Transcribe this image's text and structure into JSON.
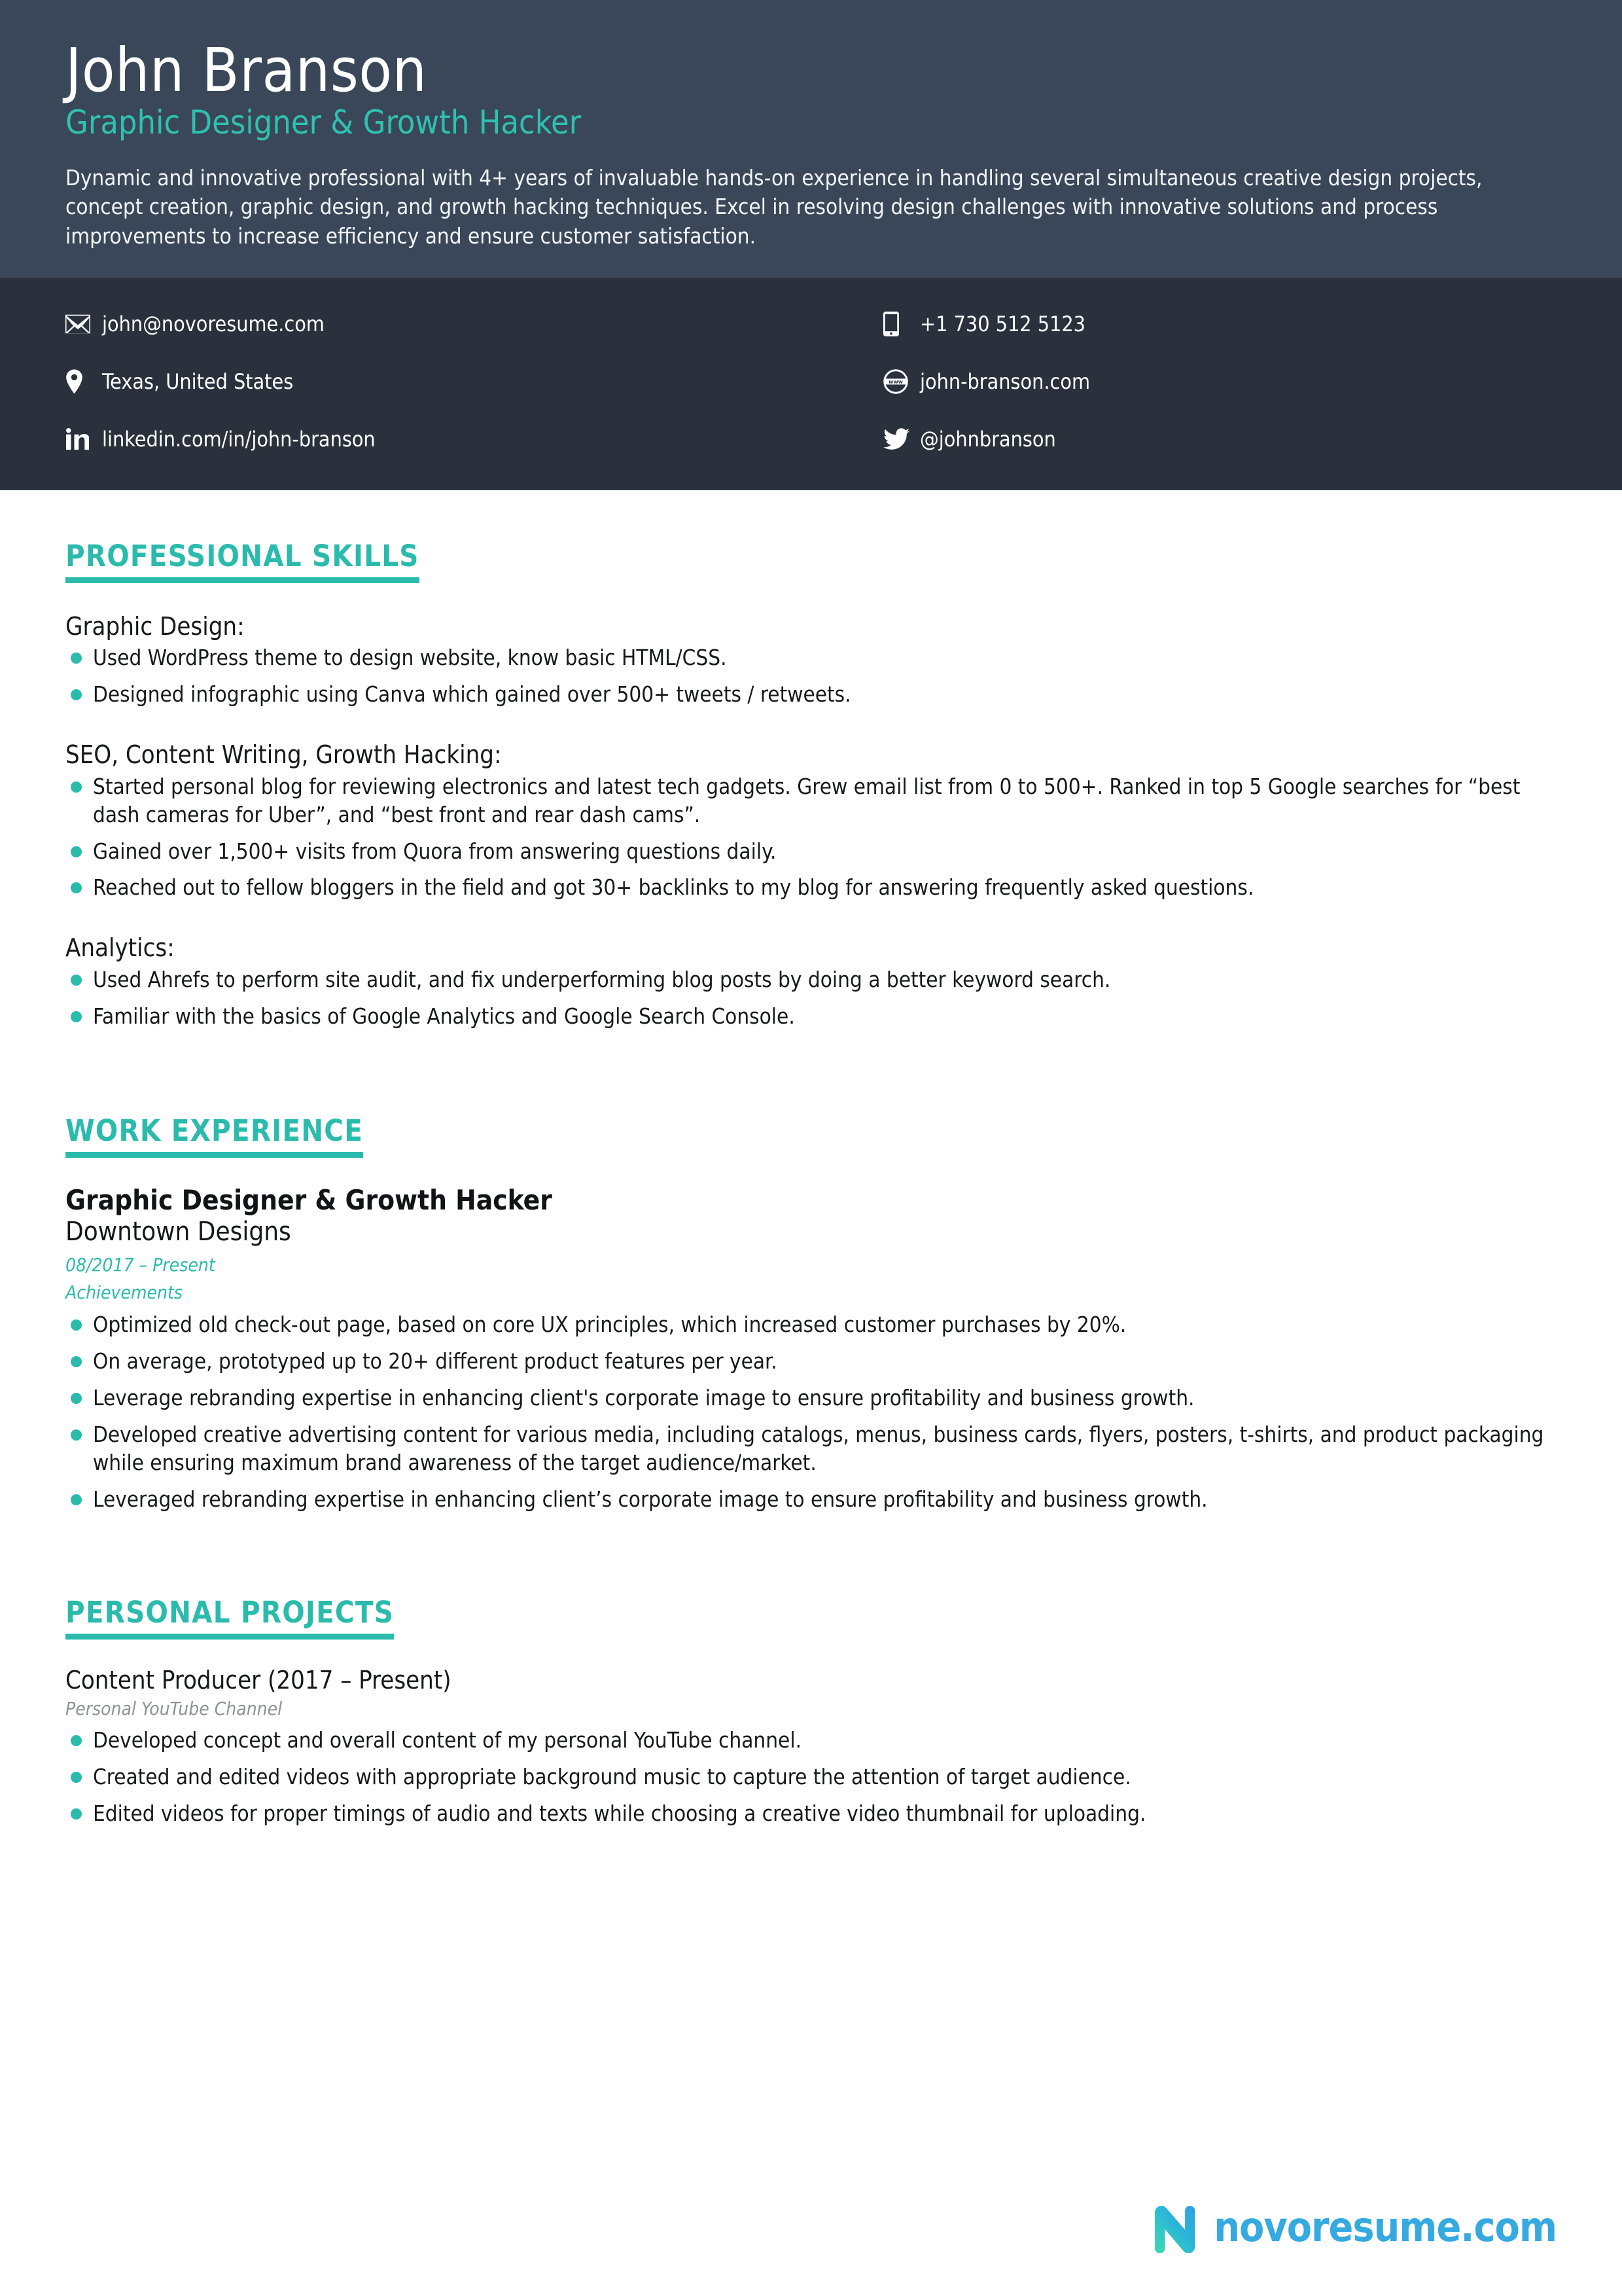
{
  "header": {
    "name": "John Branson",
    "title": "Graphic Designer & Growth Hacker",
    "summary": "Dynamic and innovative professional with 4+ years of invaluable hands-on experience in handling several simultaneous creative design projects, concept creation, graphic design, and growth hacking techniques. Excel in resolving design challenges with innovative solutions and process improvements to increase efficiency and ensure customer satisfaction."
  },
  "contact": {
    "email": "john@novoresume.com",
    "phone": "+1 730 512 5123",
    "location": "Texas, United States",
    "website": "john-branson.com",
    "linkedin": "linkedin.com/in/john-branson",
    "twitter": "@johnbranson",
    "icons": {
      "email": "envelope-icon",
      "phone": "smartphone-icon",
      "location": "map-pin-icon",
      "website": "www-globe-icon",
      "linkedin": "linkedin-icon",
      "twitter": "twitter-bird-icon"
    }
  },
  "sections": {
    "skills": {
      "heading": "PROFESSIONAL SKILLS",
      "groups": [
        {
          "label": "Graphic Design:",
          "items": [
            "Used WordPress theme to design website, know basic HTML/CSS.",
            "Designed infographic using Canva which gained over 500+ tweets / retweets."
          ]
        },
        {
          "label": "SEO, Content Writing, Growth Hacking:",
          "items": [
            "Started personal blog for reviewing electronics and latest tech gadgets. Grew email list from 0 to 500+. Ranked in top 5 Google searches for “best dash cameras for Uber”, and “best front and rear dash cams”.",
            "Gained over 1,500+ visits from Quora from answering questions daily.",
            "Reached out to fellow bloggers in the field and got 30+ backlinks to my blog for answering frequently asked questions."
          ]
        },
        {
          "label": "Analytics:",
          "items": [
            "Used Ahrefs to perform site audit, and fix underperforming blog posts by doing a better keyword search.",
            "Familiar with the basics of Google Analytics and Google Search Console."
          ]
        }
      ]
    },
    "work": {
      "heading": "WORK EXPERIENCE",
      "job_title": "Graphic Designer & Growth Hacker",
      "company": "Downtown Designs",
      "dates": "08/2017 – Present",
      "achievements_label": "Achievements",
      "achievements": [
        "Optimized old check-out page, based on core UX principles, which increased customer purchases by 20%.",
        "On average, prototyped up to 20+ different product features per year.",
        "Leverage rebranding expertise in enhancing client's corporate image to ensure profitability and business growth.",
        "Developed creative advertising content for various media, including catalogs, menus, business cards, flyers, posters, t-shirts, and product packaging while ensuring maximum brand awareness of the target audience/market.",
        "Leveraged rebranding expertise in enhancing client’s corporate image to ensure profitability and business growth."
      ]
    },
    "projects": {
      "heading": "PERSONAL PROJECTS",
      "project_title": "Content Producer (2017 – Present)",
      "project_sub": "Personal YouTube Channel",
      "items": [
        "Developed concept and overall content of my personal YouTube channel.",
        "Created and edited videos with appropriate background music to capture the attention of target audience.",
        "Edited videos for proper timings of audio and texts while choosing a creative video thumbnail for uploading."
      ]
    }
  },
  "footer": {
    "logo_text": "novoresume.com",
    "logo_icon": "novoresume-n-logo"
  },
  "colors": {
    "header_bg": "#394759",
    "contact_bg": "#2b313c",
    "accent": "#2bbbad",
    "title_accent": "#2fc1b0",
    "logo_blue": "#36a9e1",
    "muted_italic": "#8e9296"
  }
}
